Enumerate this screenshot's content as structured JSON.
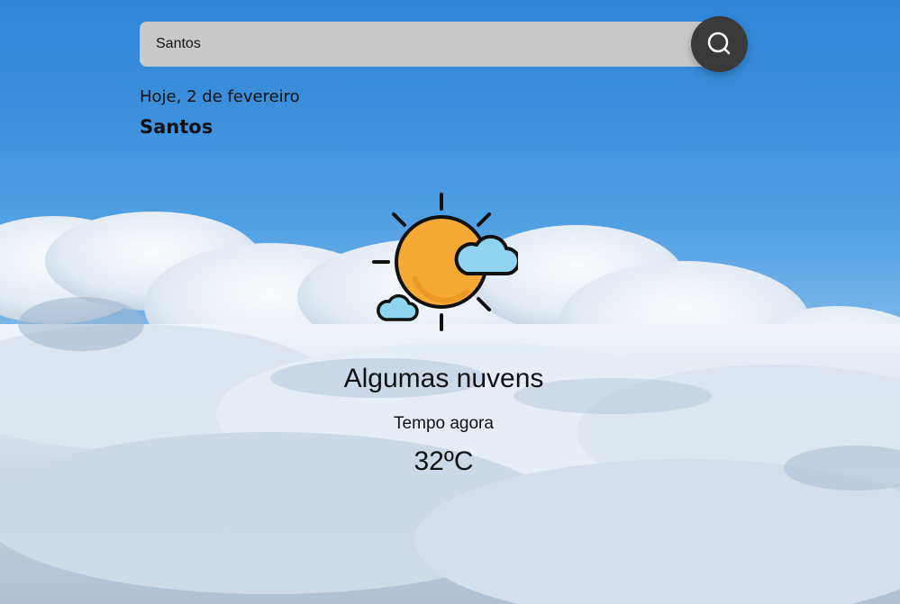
{
  "search": {
    "value": "Santos",
    "placeholder": ""
  },
  "header": {
    "date": "Hoje, 2 de fevereiro",
    "city": "Santos"
  },
  "weather": {
    "icon": "sun-behind-clouds-icon",
    "description": "Algumas nuvens",
    "label": "Tempo agora",
    "temperature": "32ºC"
  },
  "colors": {
    "sky_top": "#2f86d8",
    "search_bg": "#c9c9c9",
    "search_button_bg": "#3a3a3a",
    "sun_fill": "#f7a935",
    "cloud_fill": "#8fd3ee"
  },
  "icons": {
    "search_button": "search-icon",
    "weather": "sun-behind-clouds-icon"
  }
}
